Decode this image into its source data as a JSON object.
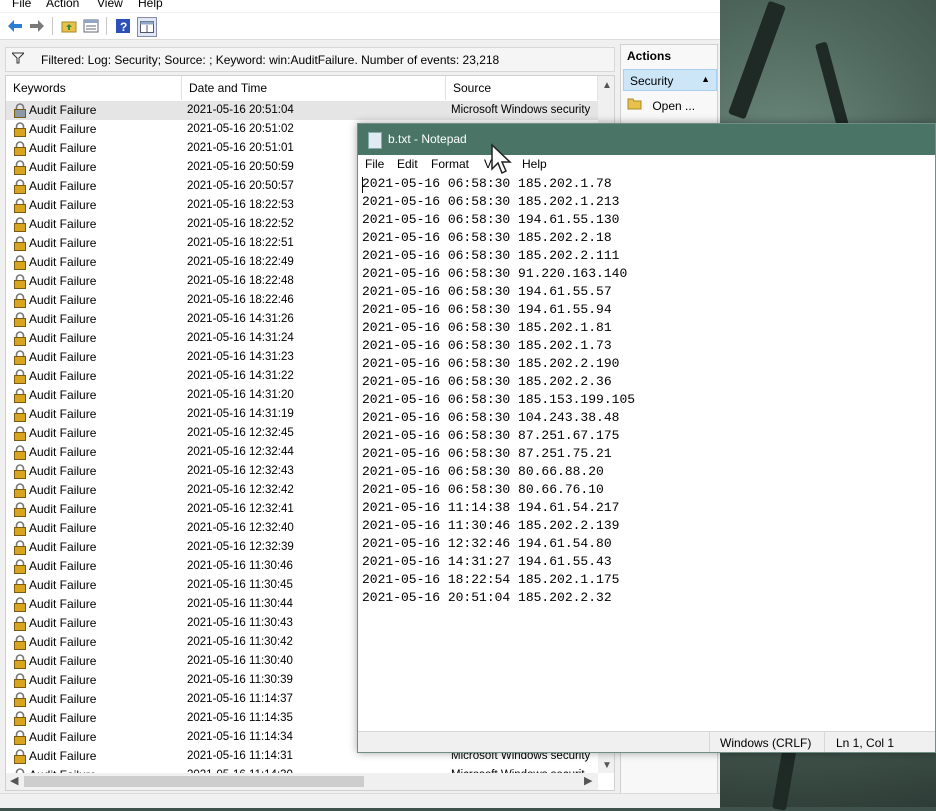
{
  "event_viewer": {
    "menu": [
      "File",
      "Action",
      "View",
      "Help"
    ],
    "filter_text": "Filtered: Log: Security; Source: ; Keyword: win:AuditFailure. Number of events: 23,218",
    "columns": [
      "Keywords",
      "Date and Time",
      "Source"
    ],
    "rows": [
      {
        "keyword": "Audit Failure",
        "datetime": "2021-05-16 20:51:04",
        "source": "Microsoft Windows security"
      },
      {
        "keyword": "Audit Failure",
        "datetime": "2021-05-16 20:51:02",
        "source": ""
      },
      {
        "keyword": "Audit Failure",
        "datetime": "2021-05-16 20:51:01",
        "source": ""
      },
      {
        "keyword": "Audit Failure",
        "datetime": "2021-05-16 20:50:59",
        "source": ""
      },
      {
        "keyword": "Audit Failure",
        "datetime": "2021-05-16 20:50:57",
        "source": ""
      },
      {
        "keyword": "Audit Failure",
        "datetime": "2021-05-16 18:22:53",
        "source": ""
      },
      {
        "keyword": "Audit Failure",
        "datetime": "2021-05-16 18:22:52",
        "source": ""
      },
      {
        "keyword": "Audit Failure",
        "datetime": "2021-05-16 18:22:51",
        "source": ""
      },
      {
        "keyword": "Audit Failure",
        "datetime": "2021-05-16 18:22:49",
        "source": ""
      },
      {
        "keyword": "Audit Failure",
        "datetime": "2021-05-16 18:22:48",
        "source": ""
      },
      {
        "keyword": "Audit Failure",
        "datetime": "2021-05-16 18:22:46",
        "source": ""
      },
      {
        "keyword": "Audit Failure",
        "datetime": "2021-05-16 14:31:26",
        "source": ""
      },
      {
        "keyword": "Audit Failure",
        "datetime": "2021-05-16 14:31:24",
        "source": ""
      },
      {
        "keyword": "Audit Failure",
        "datetime": "2021-05-16 14:31:23",
        "source": ""
      },
      {
        "keyword": "Audit Failure",
        "datetime": "2021-05-16 14:31:22",
        "source": ""
      },
      {
        "keyword": "Audit Failure",
        "datetime": "2021-05-16 14:31:20",
        "source": ""
      },
      {
        "keyword": "Audit Failure",
        "datetime": "2021-05-16 14:31:19",
        "source": ""
      },
      {
        "keyword": "Audit Failure",
        "datetime": "2021-05-16 12:32:45",
        "source": ""
      },
      {
        "keyword": "Audit Failure",
        "datetime": "2021-05-16 12:32:44",
        "source": ""
      },
      {
        "keyword": "Audit Failure",
        "datetime": "2021-05-16 12:32:43",
        "source": ""
      },
      {
        "keyword": "Audit Failure",
        "datetime": "2021-05-16 12:32:42",
        "source": ""
      },
      {
        "keyword": "Audit Failure",
        "datetime": "2021-05-16 12:32:41",
        "source": ""
      },
      {
        "keyword": "Audit Failure",
        "datetime": "2021-05-16 12:32:40",
        "source": ""
      },
      {
        "keyword": "Audit Failure",
        "datetime": "2021-05-16 12:32:39",
        "source": ""
      },
      {
        "keyword": "Audit Failure",
        "datetime": "2021-05-16 11:30:46",
        "source": ""
      },
      {
        "keyword": "Audit Failure",
        "datetime": "2021-05-16 11:30:45",
        "source": ""
      },
      {
        "keyword": "Audit Failure",
        "datetime": "2021-05-16 11:30:44",
        "source": ""
      },
      {
        "keyword": "Audit Failure",
        "datetime": "2021-05-16 11:30:43",
        "source": ""
      },
      {
        "keyword": "Audit Failure",
        "datetime": "2021-05-16 11:30:42",
        "source": ""
      },
      {
        "keyword": "Audit Failure",
        "datetime": "2021-05-16 11:30:40",
        "source": ""
      },
      {
        "keyword": "Audit Failure",
        "datetime": "2021-05-16 11:30:39",
        "source": ""
      },
      {
        "keyword": "Audit Failure",
        "datetime": "2021-05-16 11:14:37",
        "source": ""
      },
      {
        "keyword": "Audit Failure",
        "datetime": "2021-05-16 11:14:35",
        "source": ""
      },
      {
        "keyword": "Audit Failure",
        "datetime": "2021-05-16 11:14:34",
        "source": ""
      },
      {
        "keyword": "Audit Failure",
        "datetime": "2021-05-16 11:14:31",
        "source": "Microsoft Windows security"
      },
      {
        "keyword": "Audit Failure",
        "datetime": "2021-05-16 11:14:30",
        "source": "Microsoft Windows securit"
      }
    ],
    "actions": {
      "title": "Actions",
      "section": "Security",
      "open_label": "Open ..."
    },
    "icons": [
      "back-arrow-icon",
      "forward-arrow-icon",
      "folder-up-icon",
      "properties-icon",
      "help-icon",
      "panel-icon",
      "filter-icon",
      "lock-icon",
      "open-folder-icon"
    ]
  },
  "notepad": {
    "title": "b.txt - Notepad",
    "menu": [
      "File",
      "Edit",
      "Format",
      "V",
      "Help"
    ],
    "lines": [
      "2021-05-16 06:58:30 185.202.1.78",
      "2021-05-16 06:58:30 185.202.1.213",
      "2021-05-16 06:58:30 194.61.55.130",
      "2021-05-16 06:58:30 185.202.2.18",
      "2021-05-16 06:58:30 185.202.2.111",
      "2021-05-16 06:58:30 91.220.163.140",
      "2021-05-16 06:58:30 194.61.55.57",
      "2021-05-16 06:58:30 194.61.55.94",
      "2021-05-16 06:58:30 185.202.1.81",
      "2021-05-16 06:58:30 185.202.1.73",
      "2021-05-16 06:58:30 185.202.2.190",
      "2021-05-16 06:58:30 185.202.2.36",
      "2021-05-16 06:58:30 185.153.199.105",
      "2021-05-16 06:58:30 104.243.38.48",
      "2021-05-16 06:58:30 87.251.67.175",
      "2021-05-16 06:58:30 87.251.75.21",
      "2021-05-16 06:58:30 80.66.88.20",
      "2021-05-16 06:58:30 80.66.76.10",
      "2021-05-16 11:14:38 194.61.54.217",
      "2021-05-16 11:30:46 185.202.2.139",
      "2021-05-16 12:32:46 194.61.54.80",
      "2021-05-16 14:31:27 194.61.55.43",
      "2021-05-16 18:22:54 185.202.1.175",
      "2021-05-16 20:51:04 185.202.2.32"
    ],
    "status_encoding": "Windows (CRLF)",
    "status_position": "Ln 1, Col 1"
  },
  "colors": {
    "notepad_titlebar": "#4a7566",
    "selection": "#cde6f7",
    "lock_gold": "#d9a520"
  }
}
